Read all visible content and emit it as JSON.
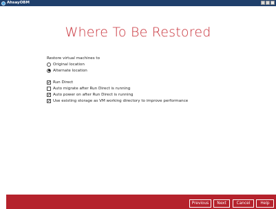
{
  "window": {
    "title": "AhsayOBM"
  },
  "heading": "Where To Be Restored",
  "restore": {
    "label": "Restore virtual machines to",
    "options": [
      {
        "label": "Original location",
        "selected": false
      },
      {
        "label": "Alternate location",
        "selected": true
      }
    ]
  },
  "checkboxes": [
    {
      "label": "Run Direct",
      "checked": true
    },
    {
      "label": "Auto migrate after Run Direct is running",
      "checked": false
    },
    {
      "label": "Auto power on after Run Direct is running",
      "checked": true
    },
    {
      "label": "Use existing storage as VM working directory to improve performance",
      "checked": true
    }
  ],
  "buttons": {
    "previous": "Previous",
    "next": "Next",
    "cancel": "Cancel",
    "help": "Help"
  },
  "colors": {
    "accent": "#b5222c",
    "heading": "#c8323a",
    "titlebar": "#1f3f6b"
  }
}
